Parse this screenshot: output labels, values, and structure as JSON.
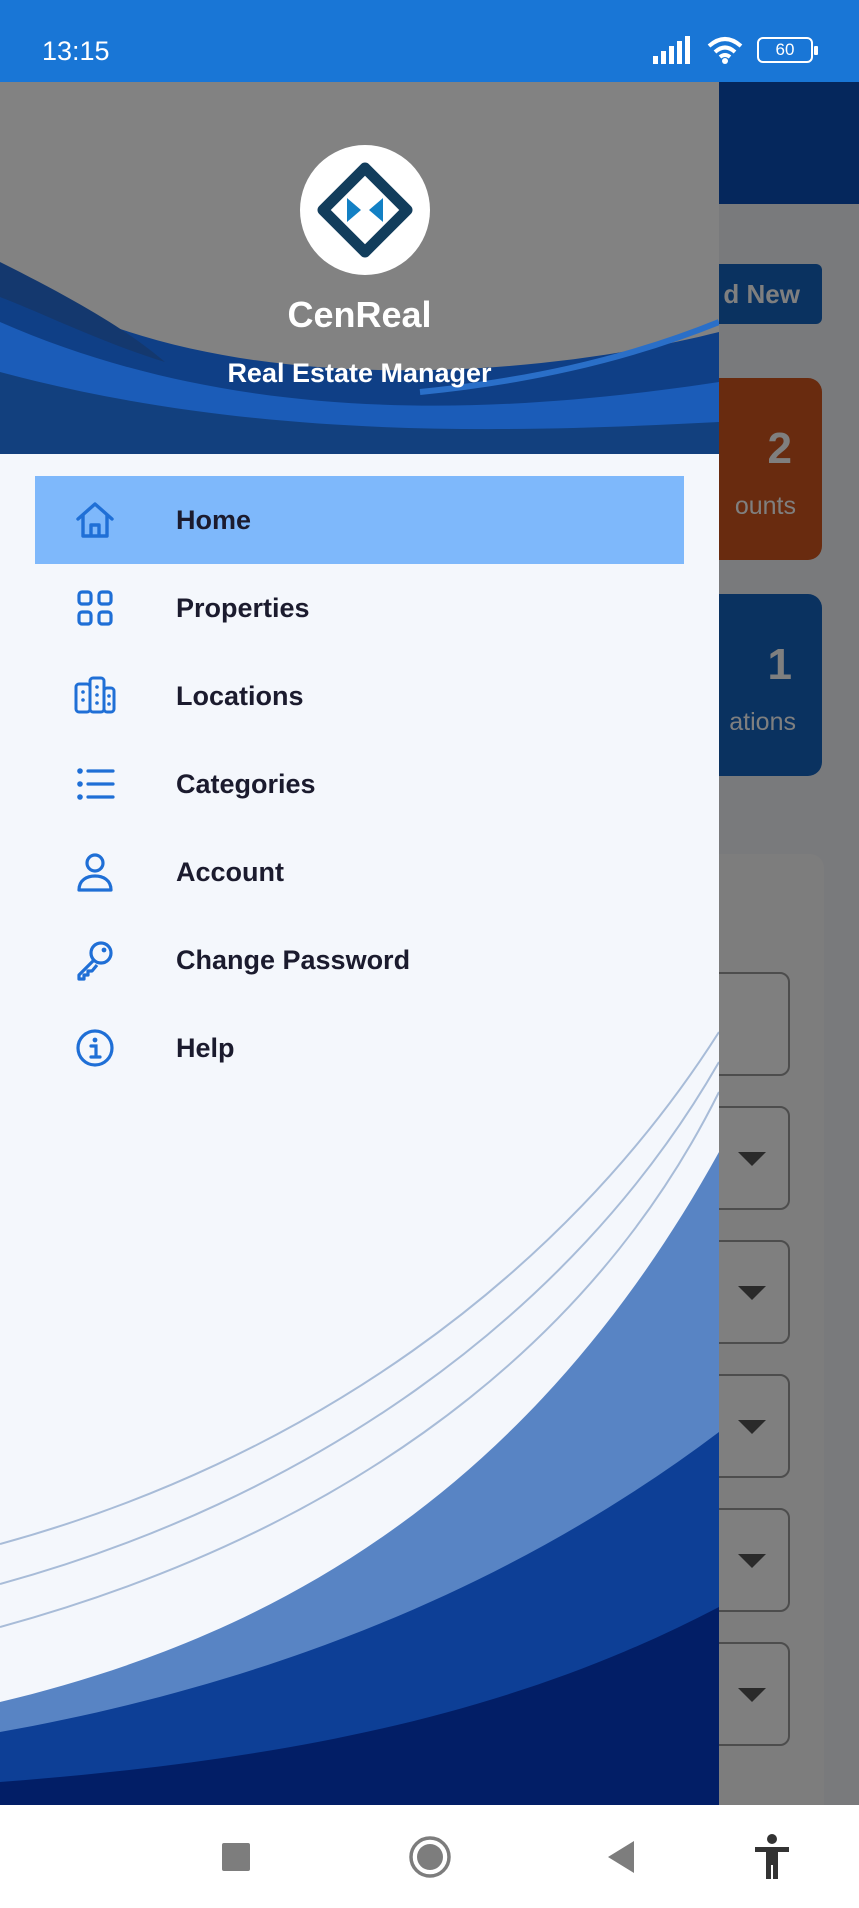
{
  "status_bar": {
    "time": "13:15",
    "battery": "60",
    "icons": [
      "signal-icon",
      "wifi-icon",
      "battery-icon"
    ]
  },
  "background": {
    "add_new_label": "d New",
    "cards": [
      {
        "value": "2",
        "label": "ounts",
        "color": "#d2571f"
      },
      {
        "value": "1",
        "label": "ations",
        "color": "#1565c0"
      }
    ]
  },
  "drawer": {
    "app_name": "CenReal",
    "app_subtitle": "Real Estate Manager",
    "menu": [
      {
        "label": "Home",
        "icon": "home-icon",
        "active": true
      },
      {
        "label": "Properties",
        "icon": "grid-icon",
        "active": false
      },
      {
        "label": "Locations",
        "icon": "buildings-icon",
        "active": false
      },
      {
        "label": "Categories",
        "icon": "list-icon",
        "active": false
      },
      {
        "label": "Account",
        "icon": "user-icon",
        "active": false
      },
      {
        "label": "Change Password",
        "icon": "key-icon",
        "active": false
      },
      {
        "label": "Help",
        "icon": "info-icon",
        "active": false
      }
    ]
  },
  "nav_bar": {
    "icons": [
      "recents-icon",
      "home-circle-icon",
      "back-icon",
      "accessibility-icon"
    ]
  },
  "colors": {
    "status_bar": "#1976d6",
    "active_item": "#7eb8fb",
    "icon_blue": "#1f6fd6",
    "drawer_bg": "#f4f7fc"
  }
}
